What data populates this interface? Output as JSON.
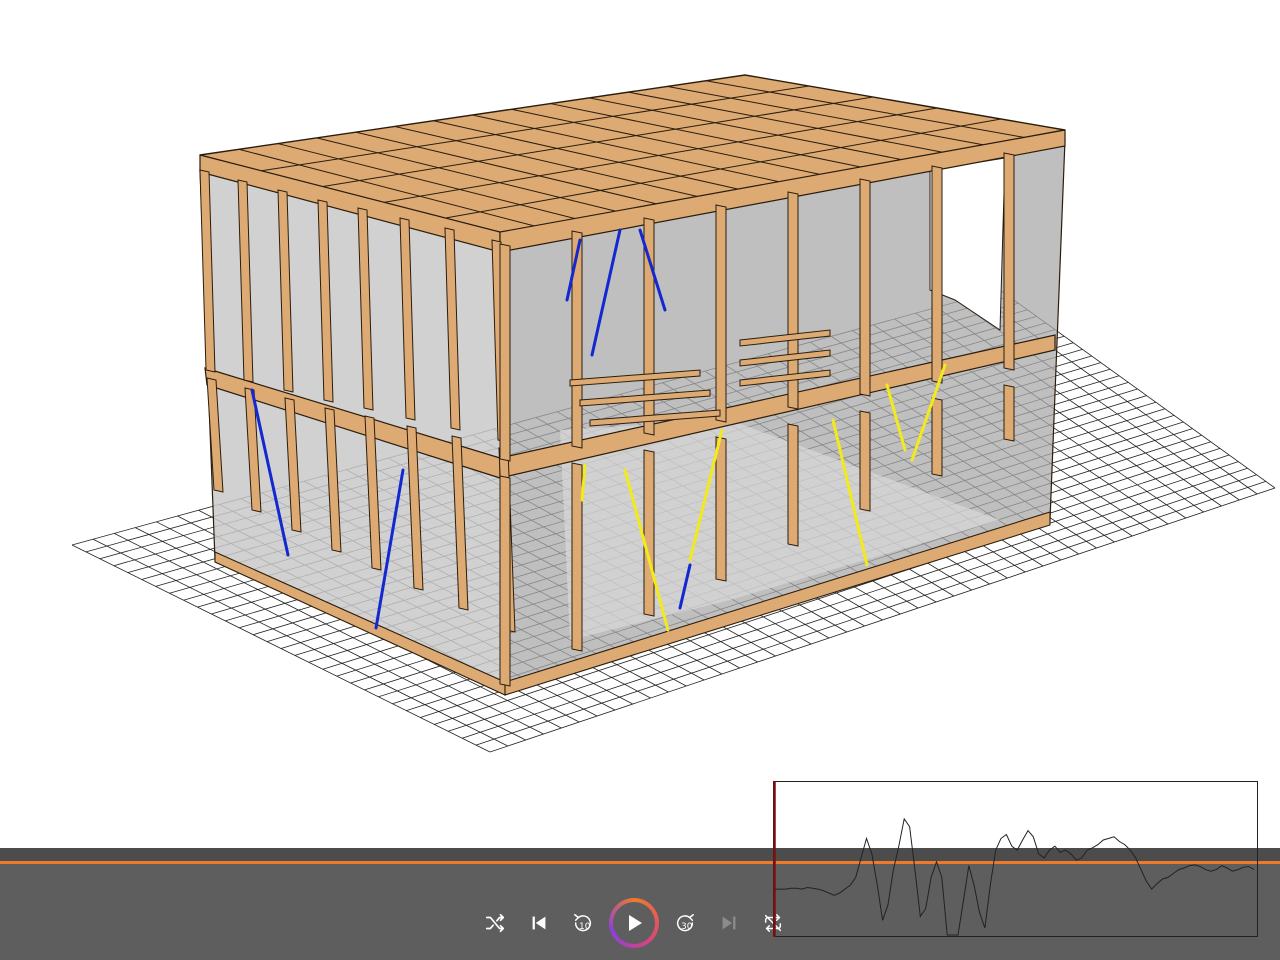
{
  "scene": {
    "description_icon": "timber-frame-house-3d-model",
    "colors": {
      "timber": "#dcaa72",
      "timber_edge": "#2b1d0e",
      "panel": "#b8b8b8",
      "grid": "#222222",
      "brace_blue": "#1428d0",
      "brace_yellow": "#f2ea1c"
    }
  },
  "waveform": {
    "cursor_color": "#7a1010",
    "line_color": "#222222",
    "samples": [
      0.05,
      0.05,
      0.05,
      0.06,
      0.06,
      0.05,
      0.07,
      0.06,
      0.05,
      0.03,
      0.0,
      -0.03,
      0.0,
      0.05,
      0.1,
      0.2,
      0.45,
      0.7,
      0.5,
      0.1,
      -0.35,
      -0.15,
      0.3,
      0.6,
      0.95,
      0.85,
      0.3,
      -0.3,
      -0.2,
      0.2,
      0.4,
      0.2,
      -0.6,
      -0.95,
      -0.6,
      -0.1,
      0.35,
      0.1,
      -0.25,
      -0.45,
      0.1,
      0.55,
      0.7,
      0.75,
      0.6,
      0.55,
      0.68,
      0.8,
      0.72,
      0.5,
      0.45,
      0.55,
      0.6,
      0.52,
      0.55,
      0.5,
      0.42,
      0.45,
      0.55,
      0.58,
      0.62,
      0.68,
      0.7,
      0.72,
      0.66,
      0.62,
      0.55,
      0.45,
      0.3,
      0.15,
      0.05,
      0.12,
      0.18,
      0.2,
      0.25,
      0.3,
      0.32,
      0.35,
      0.36,
      0.34,
      0.3,
      0.28,
      0.3,
      0.35,
      0.32,
      0.28,
      0.3,
      0.33,
      0.34,
      0.3
    ]
  },
  "player": {
    "progress": 1.0,
    "accent_color": "#ee7a2c",
    "buttons": [
      {
        "name": "shuffle",
        "icon": "shuffle-icon",
        "enabled": true
      },
      {
        "name": "previous",
        "icon": "skip-previous-icon",
        "enabled": true
      },
      {
        "name": "rewind",
        "icon": "rewind-icon",
        "label": "10",
        "enabled": true
      },
      {
        "name": "play",
        "icon": "play-icon",
        "enabled": true
      },
      {
        "name": "forward",
        "icon": "fast-forward-icon",
        "label": "30",
        "enabled": true
      },
      {
        "name": "next",
        "icon": "skip-next-icon",
        "enabled": false
      },
      {
        "name": "repeat",
        "icon": "repeat-off-icon",
        "enabled": true
      }
    ],
    "rewind_label": "10",
    "forward_label": "30"
  }
}
